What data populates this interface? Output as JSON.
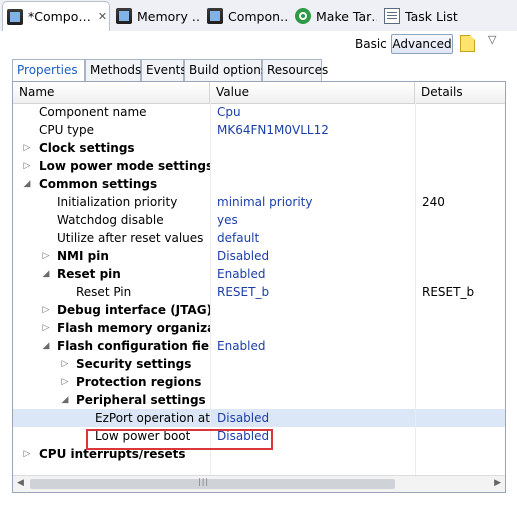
{
  "editor_tabs": [
    {
      "label": "*Compo…",
      "icon": "chip-icon",
      "active": true
    },
    {
      "label": "Memory …",
      "icon": "chip-icon"
    },
    {
      "label": "Compon…",
      "icon": "chip-icon"
    },
    {
      "label": "Make Tar…",
      "icon": "target-icon"
    },
    {
      "label": "Task List",
      "icon": "task-list-icon"
    }
  ],
  "mode": {
    "basic": "Basic",
    "advanced": "Advanced",
    "selected": "Advanced"
  },
  "tabs": [
    "Properties",
    "Methods",
    "Events",
    "Build options",
    "Resources"
  ],
  "columns": [
    "Name",
    "Value",
    "Details"
  ],
  "rows": [
    {
      "name": "Component name",
      "value": "Cpu",
      "details": ""
    },
    {
      "name": "CPU type",
      "value": "MK64FN1M0VLL12",
      "details": ""
    },
    {
      "name": "Clock settings",
      "value": "",
      "details": ""
    },
    {
      "name": "Low power mode settings",
      "value": "",
      "details": ""
    },
    {
      "name": "Common settings",
      "value": "",
      "details": ""
    },
    {
      "name": "Initialization priority",
      "value": "minimal priority",
      "details": "240"
    },
    {
      "name": "Watchdog disable",
      "value": "yes",
      "details": ""
    },
    {
      "name": "Utilize after reset values",
      "value": "default",
      "details": ""
    },
    {
      "name": "NMI pin",
      "value": "Disabled",
      "details": ""
    },
    {
      "name": "Reset pin",
      "value": "Enabled",
      "details": ""
    },
    {
      "name": "Reset Pin",
      "value": "RESET_b",
      "details": "RESET_b"
    },
    {
      "name": "Debug interface (JTAG)",
      "value": "",
      "details": ""
    },
    {
      "name": "Flash memory organization",
      "value": "",
      "details": ""
    },
    {
      "name": "Flash configuration field",
      "value": "Enabled",
      "details": ""
    },
    {
      "name": "Security settings",
      "value": "",
      "details": ""
    },
    {
      "name": "Protection regions",
      "value": "",
      "details": ""
    },
    {
      "name": "Peripheral settings",
      "value": "",
      "details": ""
    },
    {
      "name": "EzPort operation at bc",
      "value": "Disabled",
      "details": ""
    },
    {
      "name": "Low power boot",
      "value": "Disabled",
      "details": ""
    },
    {
      "name": "CPU interrupts/resets",
      "value": "",
      "details": ""
    },
    {
      "name": "",
      "value": "",
      "details": ""
    }
  ]
}
